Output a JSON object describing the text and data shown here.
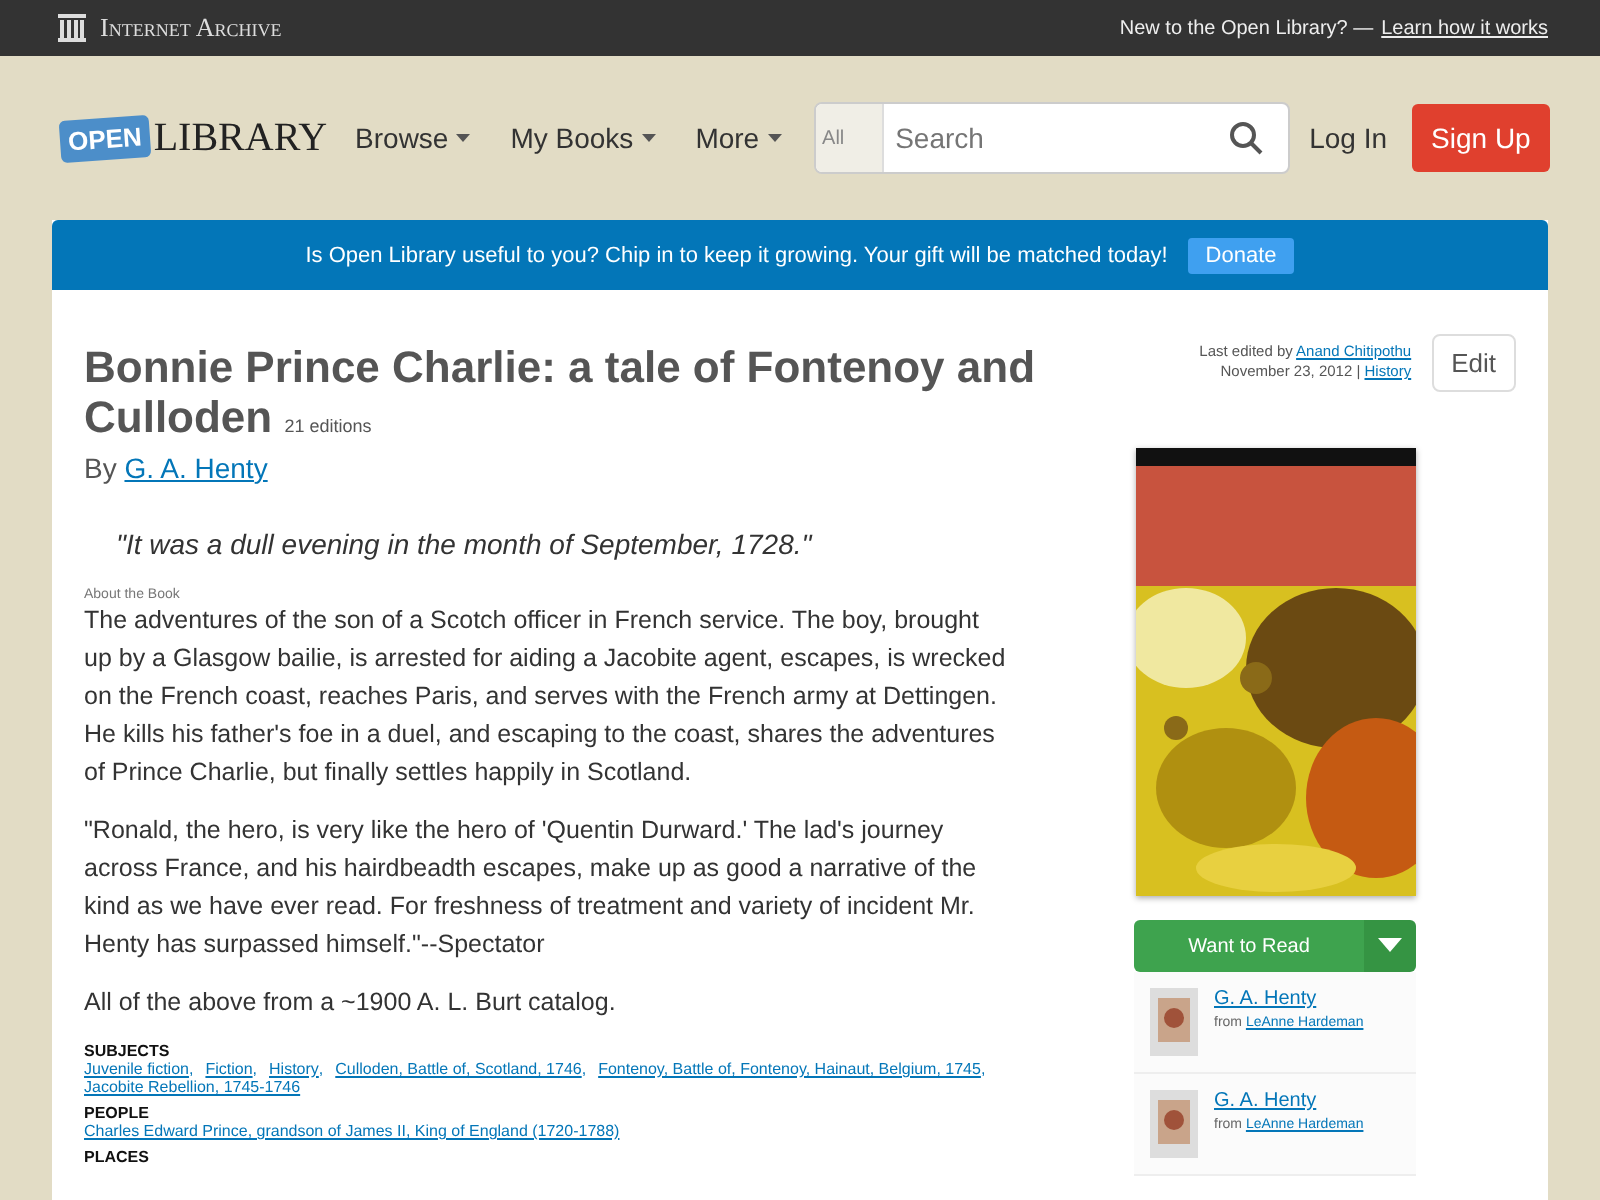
{
  "top_bar": {
    "brand": "Internet Archive",
    "prompt": "New to the Open Library? —",
    "link": "Learn how it works"
  },
  "header": {
    "logo_badge": "OPEN",
    "logo_word": "LIBRARY",
    "nav": [
      "Browse",
      "My Books",
      "More"
    ],
    "search": {
      "scope": "All",
      "placeholder": "Search"
    },
    "login": "Log In",
    "signup": "Sign Up"
  },
  "banner": {
    "text": "Is Open Library useful to you? Chip in to keep it growing. Your gift will be matched today!",
    "button": "Donate"
  },
  "work": {
    "title": "Bonnie Prince Charlie: a tale of Fontenoy and Culloden",
    "editions": "21 editions",
    "by": "By",
    "author": "G. A. Henty",
    "edited_prefix": "Last edited by",
    "editor": "Anand Chitipothu",
    "edited_date": "November 23, 2012 |",
    "history": "History",
    "edit": "Edit",
    "first_sentence": "\"It was a dull evening in the month of September, 1728.\"",
    "about_label": "About the Book",
    "paragraphs": [
      "The adventures of the son of a Scotch officer in French service. The boy, brought up by a Glasgow bailie, is arrested for aiding a Jacobite agent, escapes, is wrecked on the French coast, reaches Paris, and serves with the French army at Dettingen. He kills his father's foe in a duel, and escaping to the coast, shares the adventures of Prince Charlie, but finally settles happily in Scotland.",
      "\"Ronald, the hero, is very like the hero of 'Quentin Durward.' The lad's journey across France, and his hairdbeadth escapes, make up as good a narrative of the kind as we have ever read. For freshness of treatment and variety of incident Mr. Henty has surpassed himself.\"--Spectator",
      "All of the above from a ~1900 A. L. Burt catalog."
    ],
    "sections": [
      {
        "heading": "SUBJECTS",
        "separator": ",",
        "links": [
          "Juvenile fiction",
          "Fiction",
          "History",
          "Culloden, Battle of, Scotland, 1746",
          "Fontenoy, Battle of, Fontenoy, Hainaut, Belgium, 1745",
          "Jacobite Rebellion, 1745-1746"
        ]
      },
      {
        "heading": "PEOPLE",
        "links": [
          "Charles Edward Prince, grandson of James II, King of England (1720-1788)"
        ]
      },
      {
        "heading": "PLACES"
      }
    ],
    "want_to_read": "Want to Read",
    "lists": [
      {
        "title": "G. A. Henty",
        "from": "from",
        "owner": "LeAnne Hardeman"
      },
      {
        "title": "G. A. Henty",
        "from": "from",
        "owner": "LeAnne Hardeman"
      }
    ]
  }
}
